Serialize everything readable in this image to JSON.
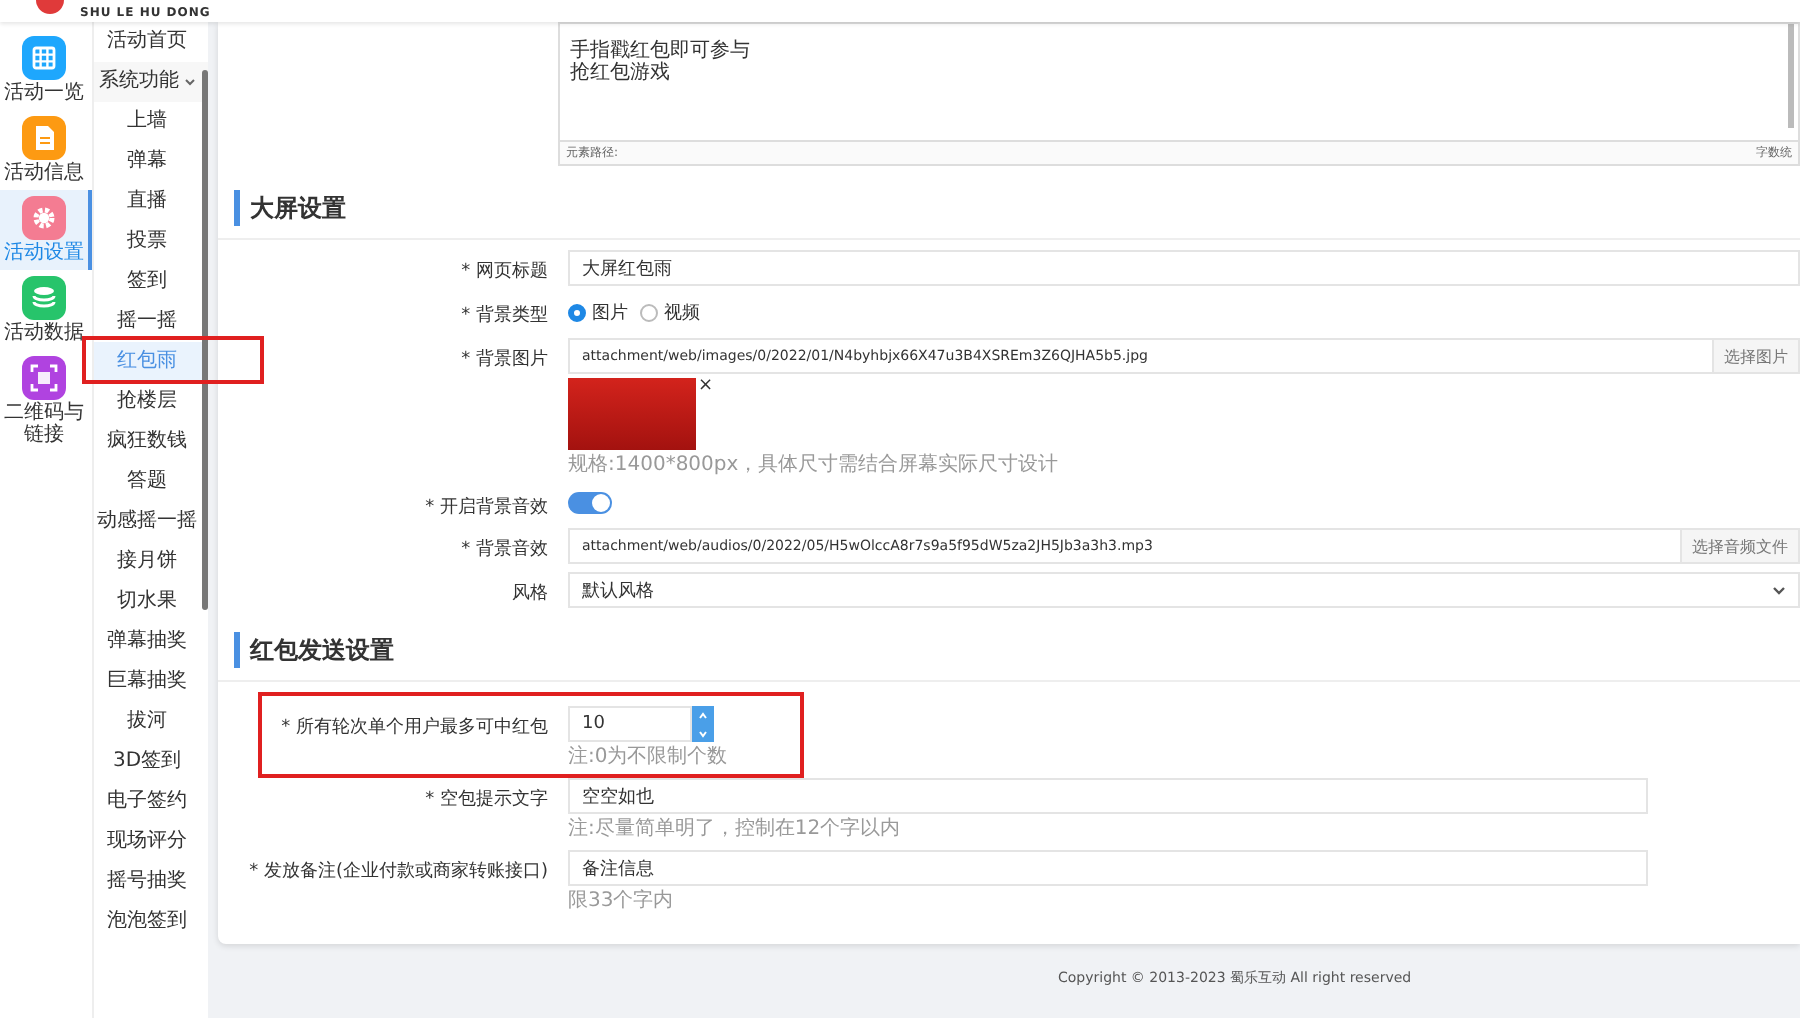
{
  "header": {
    "logo_text": "SHU LE HU DONG"
  },
  "nav": [
    {
      "label": "活动一览",
      "kind": "grid",
      "color": "#1ea7fd",
      "selected": false
    },
    {
      "label": "活动信息",
      "kind": "doc",
      "color": "#fd9a12",
      "selected": false
    },
    {
      "label": "活动设置",
      "kind": "gear",
      "color": "#f47c92",
      "selected": true
    },
    {
      "label": "活动数据",
      "kind": "db",
      "color": "#27c46b",
      "selected": false
    },
    {
      "label": "二维码与链接",
      "kind": "qr",
      "color": "#b043e0",
      "selected": false
    }
  ],
  "submenu": [
    {
      "label": "活动首页",
      "selected": false
    },
    {
      "label": "系统功能",
      "selected": false,
      "expanded": true,
      "children": [
        {
          "label": "上墙",
          "selected": false
        },
        {
          "label": "弹幕",
          "selected": false
        },
        {
          "label": "直播",
          "selected": false
        },
        {
          "label": "投票",
          "selected": false
        },
        {
          "label": "签到",
          "selected": false
        },
        {
          "label": "摇一摇",
          "selected": false
        },
        {
          "label": "红包雨",
          "selected": true
        },
        {
          "label": "抢楼层",
          "selected": false
        },
        {
          "label": "疯狂数钱",
          "selected": false
        },
        {
          "label": "答题",
          "selected": false
        },
        {
          "label": "动感摇一摇",
          "selected": false
        },
        {
          "label": "接月饼",
          "selected": false
        },
        {
          "label": "切水果",
          "selected": false
        },
        {
          "label": "弹幕抽奖",
          "selected": false
        },
        {
          "label": "巨幕抽奖",
          "selected": false
        },
        {
          "label": "拔河",
          "selected": false
        },
        {
          "label": "3D签到",
          "selected": false
        },
        {
          "label": "电子签约",
          "selected": false
        },
        {
          "label": "现场评分",
          "selected": false
        },
        {
          "label": "摇号抽奖",
          "selected": false
        },
        {
          "label": "泡泡签到",
          "selected": false
        }
      ]
    }
  ],
  "editor": {
    "lines": [
      "手指戳红包即可参与",
      "抢红包游戏"
    ],
    "path_label": "元素路径:",
    "count_label": "字数统"
  },
  "sections": [
    {
      "title": "大屏设置",
      "fields": [
        {
          "kind": "text",
          "label": "* 网页标题",
          "value": "大屏红包雨"
        },
        {
          "kind": "radio",
          "label": "* 背景类型",
          "options": [
            {
              "label": "图片",
              "selected": true
            },
            {
              "label": "视频",
              "selected": false
            }
          ]
        },
        {
          "kind": "image",
          "label": "* 背景图片",
          "value": "attachment/web/images/0/2022/01/N4byhbjx66X47u3B4XSREm3Z6QJHA5b5.jpg",
          "button": "选择图片",
          "remove": "×",
          "hint": "规格:1400*800px，具体尺寸需结合屏幕实际尺寸设计"
        },
        {
          "kind": "toggle",
          "label": "* 开启背景音效",
          "on": true
        },
        {
          "kind": "file",
          "label": "* 背景音效",
          "value": "attachment/web/audios/0/2022/05/H5wOlccA8r7s9a5f95dW5za2JH5Jb3a3h3.mp3",
          "button": "选择音频文件"
        },
        {
          "kind": "select",
          "label": "风格",
          "value": "默认风格"
        }
      ]
    },
    {
      "title": "红包发送设置",
      "fields": [
        {
          "kind": "number",
          "label": "* 所有轮次单个用户最多可中红包",
          "value": "10",
          "hint": "注:0为不限制个数"
        },
        {
          "kind": "text",
          "label": "* 空包提示文字",
          "value": "空空如也",
          "hint": "注:尽量简单明了，控制在12个字以内"
        },
        {
          "kind": "text",
          "label": "* 发放备注(企业付款或商家转账接口)",
          "value": "备注信息",
          "hint": "限33个字内"
        }
      ]
    }
  ],
  "footer": {
    "copyright": "Copyright © 2013-2023 蜀乐互动 All right reserved"
  }
}
